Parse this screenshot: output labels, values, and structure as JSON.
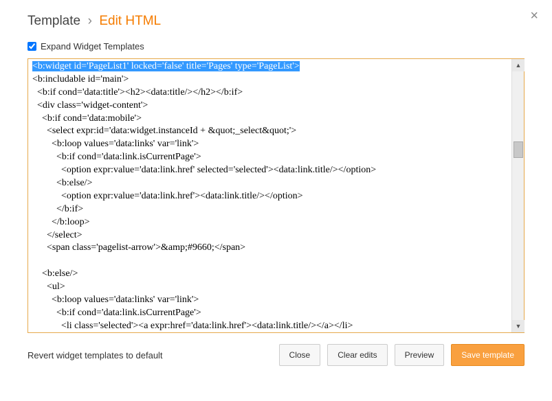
{
  "header": {
    "title": "Template",
    "separator": "›",
    "sub": "Edit HTML"
  },
  "expand": {
    "label": "Expand Widget Templates",
    "checked": true
  },
  "code": {
    "highlighted": "<b:widget id='PageList1' locked='false' title='Pages' type='PageList'>",
    "rest": "<b:includable id='main'>\n  <b:if cond='data:title'><h2><data:title/></h2></b:if>\n  <div class='widget-content'>\n    <b:if cond='data:mobile'>\n      <select expr:id='data:widget.instanceId + &quot;_select&quot;'>\n        <b:loop values='data:links' var='link'>\n          <b:if cond='data:link.isCurrentPage'>\n            <option expr:value='data:link.href' selected='selected'><data:link.title/></option>\n          <b:else/>\n            <option expr:value='data:link.href'><data:link.title/></option>\n          </b:if>\n        </b:loop>\n      </select>\n      <span class='pagelist-arrow'>&amp;#9660;</span>\n\n    <b:else/>\n      <ul>\n        <b:loop values='data:links' var='link'>\n          <b:if cond='data:link.isCurrentPage'>\n            <li class='selected'><a expr:href='data:link.href'><data:link.title/></a></li>\n          <b:else/>\n            <li><a expr:href='data:link.href'><data:link.title/></a></li>\n          </b:if>\n        </b:loop>"
  },
  "footer": {
    "revert": "Revert widget templates to default",
    "close": "Close",
    "clear": "Clear edits",
    "preview": "Preview",
    "save": "Save template"
  },
  "close_x": "×"
}
